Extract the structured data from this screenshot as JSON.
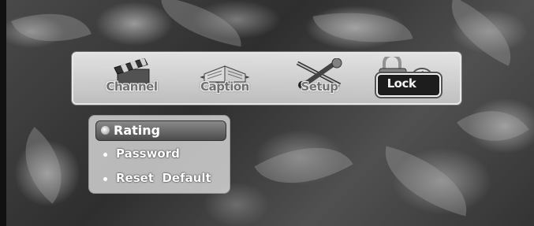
{
  "top_menu": {
    "items": [
      {
        "label": "Channel",
        "icon": "clapperboard-icon"
      },
      {
        "label": "Caption",
        "icon": "book-icon"
      },
      {
        "label": "Setup",
        "icon": "tools-icon"
      },
      {
        "label": "Lock",
        "icon": "padlock-icon"
      }
    ],
    "active_index": 3
  },
  "submenu": {
    "items": [
      {
        "label": "Rating"
      },
      {
        "label": "Password"
      },
      {
        "label": "Reset  Default"
      }
    ],
    "selected_index": 0
  }
}
